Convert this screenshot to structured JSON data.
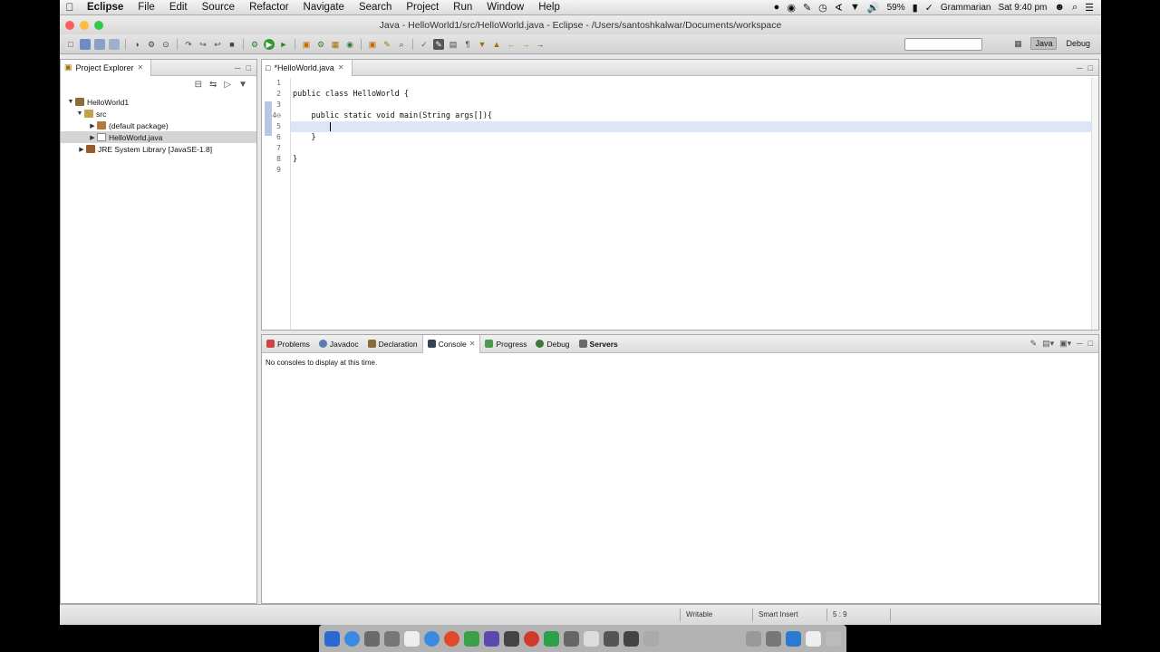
{
  "menubar": {
    "apple": "",
    "app_name": "Eclipse",
    "items": [
      "File",
      "Edit",
      "Source",
      "Refactor",
      "Navigate",
      "Search",
      "Project",
      "Run",
      "Window",
      "Help"
    ],
    "battery": "59%",
    "user": "Grammarian",
    "clock": "Sat 9:40 pm"
  },
  "window": {
    "title": "Java - HelloWorld1/src/HelloWorld.java - Eclipse - /Users/santoshkalwar/Documents/workspace",
    "perspectives": [
      "Java",
      "Debug"
    ]
  },
  "explorer": {
    "tab_label": "Project Explorer",
    "tree": [
      {
        "label": "HelloWorld1",
        "depth": 0,
        "expanded": true
      },
      {
        "label": "src",
        "depth": 1,
        "expanded": true
      },
      {
        "label": "(default package)",
        "depth": 2,
        "expanded": false
      },
      {
        "label": "HelloWorld.java",
        "depth": 2,
        "expanded": false,
        "selected": true
      },
      {
        "label": "JRE System Library [JavaSE-1.8]",
        "depth": 1,
        "expanded": false
      }
    ]
  },
  "editor": {
    "tab_label": "*HelloWorld.java",
    "line_numbers": [
      "1",
      "2",
      "3",
      "4⊖",
      "5",
      "6",
      "7",
      "8",
      "9"
    ],
    "lines": [
      "",
      "public class HelloWorld {",
      "",
      "    public static void main(String args[]){",
      "        ",
      "    }",
      "",
      "}",
      ""
    ],
    "current_line": 5
  },
  "console": {
    "tabs": [
      "Problems",
      "Javadoc",
      "Declaration",
      "Console",
      "Progress",
      "Debug",
      "Servers"
    ],
    "active_tab": "Console",
    "message": "No consoles to display at this time."
  },
  "status": {
    "writable": "Writable",
    "insert_mode": "Smart Insert",
    "position": "5 : 9"
  }
}
